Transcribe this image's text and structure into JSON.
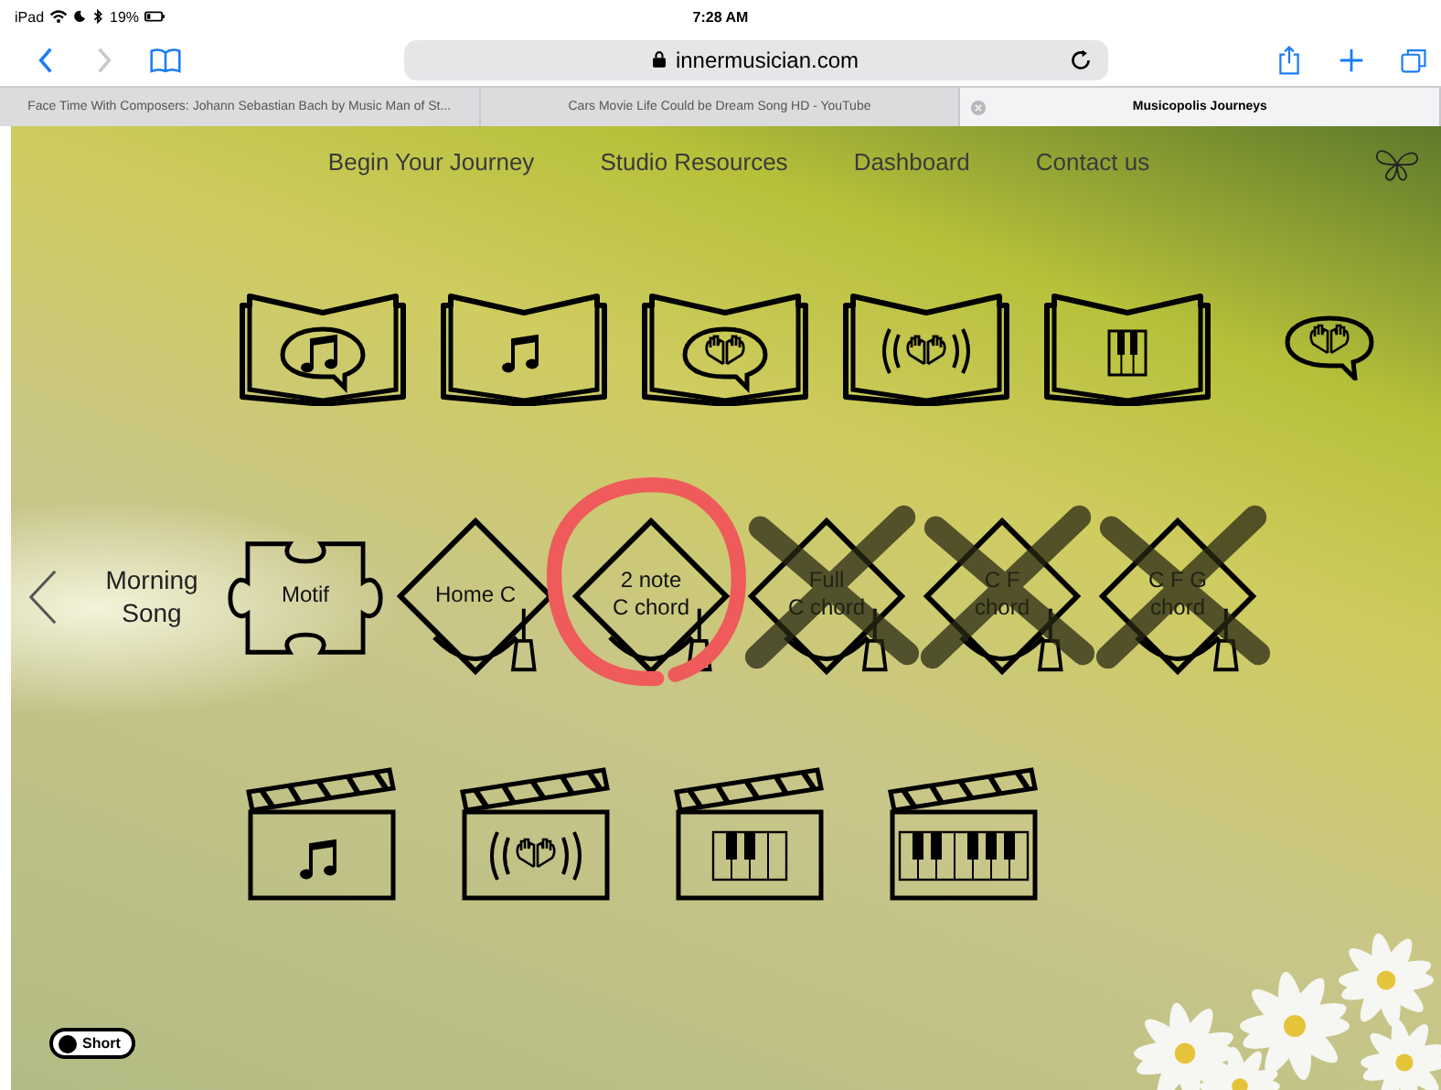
{
  "status_bar": {
    "device": "iPad",
    "time": "7:28 AM",
    "battery": "19%"
  },
  "toolbar": {
    "address": "innermusician.com"
  },
  "tabs": [
    {
      "title": "Face Time With Composers: Johann Sebastian Bach by Music Man of St...",
      "selected": false
    },
    {
      "title": "Cars Movie Life Could be Dream Song HD - YouTube",
      "selected": false
    },
    {
      "title": "Musicopolis Journeys",
      "selected": true
    }
  ],
  "nav": [
    "Begin Your Journey",
    "Studio Resources",
    "Dashboard",
    "Contact us"
  ],
  "books": [
    {
      "kind": "note-bubble"
    },
    {
      "kind": "note"
    },
    {
      "kind": "hands-bubble"
    },
    {
      "kind": "hands-waves"
    },
    {
      "kind": "piano"
    }
  ],
  "lesson": {
    "title": "Morning Song",
    "items": [
      {
        "kind": "puzzle",
        "label": "Motif",
        "crossed": false,
        "circled": false
      },
      {
        "kind": "cap",
        "label": "Home C",
        "crossed": false,
        "circled": false
      },
      {
        "kind": "cap",
        "label": "2 note\nC chord",
        "crossed": false,
        "circled": true
      },
      {
        "kind": "cap",
        "label": "Full\nC chord",
        "crossed": true,
        "circled": false
      },
      {
        "kind": "cap",
        "label": "C F\nchord",
        "crossed": true,
        "circled": false
      },
      {
        "kind": "cap",
        "label": "C F G\nchord",
        "crossed": true,
        "circled": false
      }
    ]
  },
  "clips": [
    {
      "kind": "note"
    },
    {
      "kind": "hands-waves"
    },
    {
      "kind": "piano-small"
    },
    {
      "kind": "piano-large"
    }
  ],
  "toggle": {
    "label": "Short"
  }
}
